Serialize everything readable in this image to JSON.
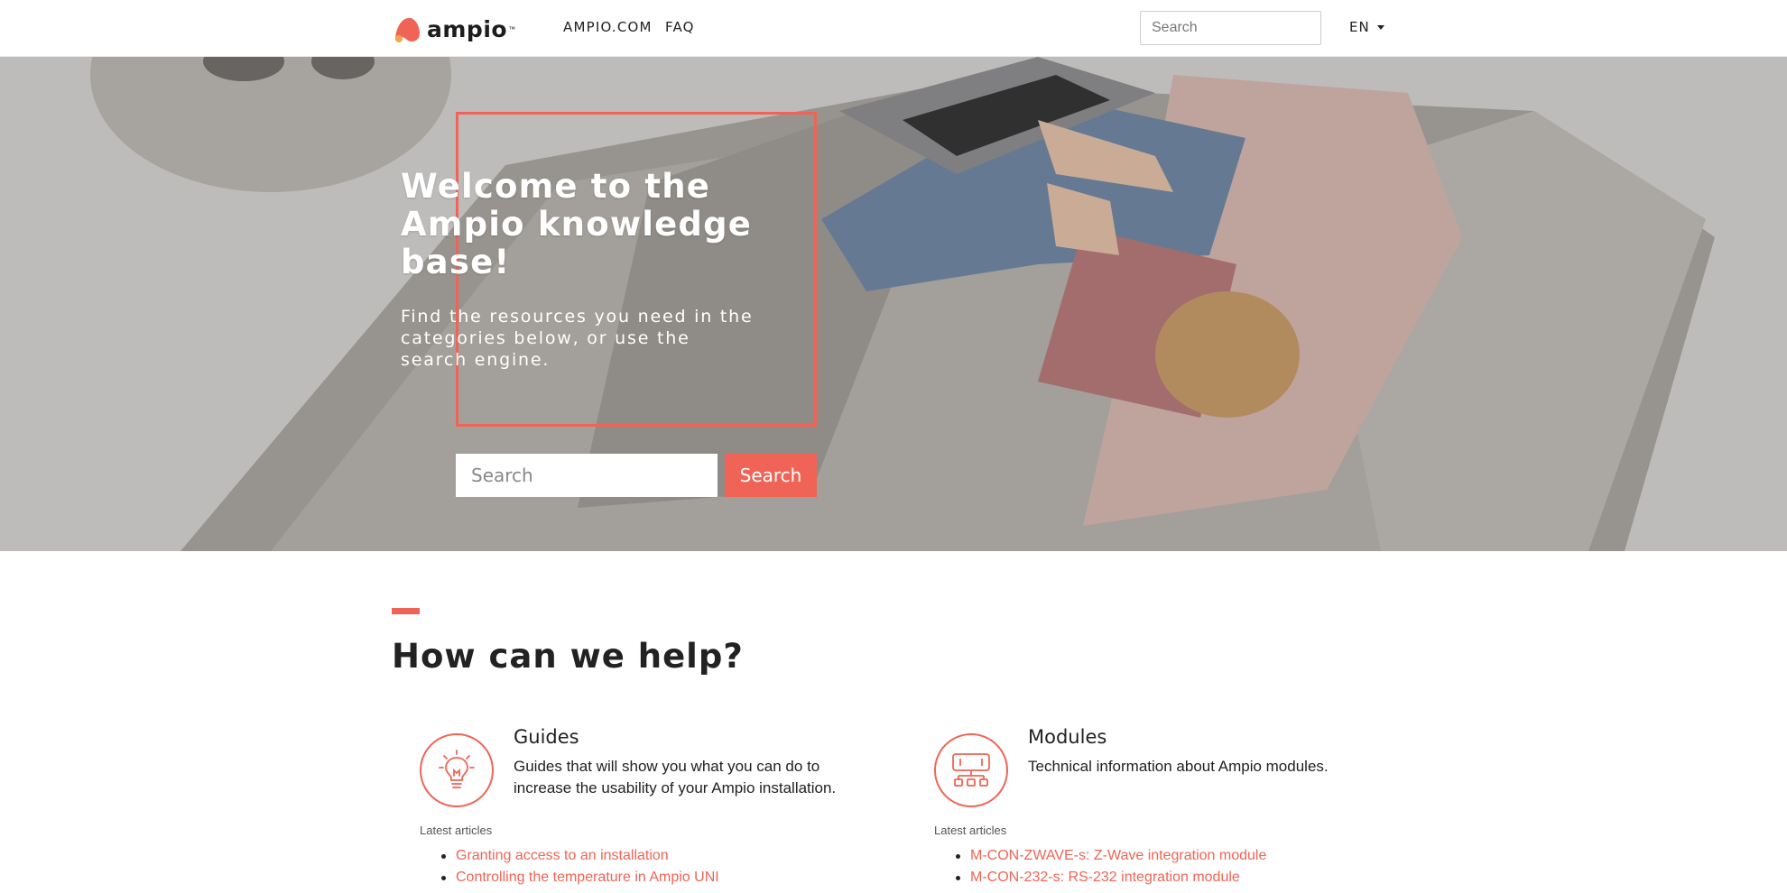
{
  "nav": {
    "logo_text": "ampio",
    "logo_tm": "™",
    "links": [
      {
        "label": "AMPIO.COM"
      },
      {
        "label": "FAQ"
      }
    ],
    "search_placeholder": "Search",
    "language": "EN"
  },
  "hero": {
    "title": "Welcome to the Ampio knowledge base!",
    "subtitle": "Find the resources you need in the categories below, or use the search engine.",
    "search_placeholder": "Search",
    "search_button": "Search"
  },
  "help": {
    "title": "How can we help?",
    "categories": [
      {
        "title": "Guides",
        "description": "Guides that will show you what you can do to increase the usability of your Ampio installation.",
        "icon": "lightbulb-icon",
        "latest_label": "Latest articles",
        "articles": [
          "Granting access to an installation",
          "Controlling the temperature in Ampio UNI"
        ]
      },
      {
        "title": "Modules",
        "description": "Technical information about Ampio modules.",
        "icon": "module-network-icon",
        "latest_label": "Latest articles",
        "articles": [
          "M-CON-ZWAVE-s: Z-Wave integration module",
          "M-CON-232-s: RS-232 integration module"
        ]
      }
    ]
  },
  "colors": {
    "accent": "#ef6456",
    "text": "#222222"
  }
}
